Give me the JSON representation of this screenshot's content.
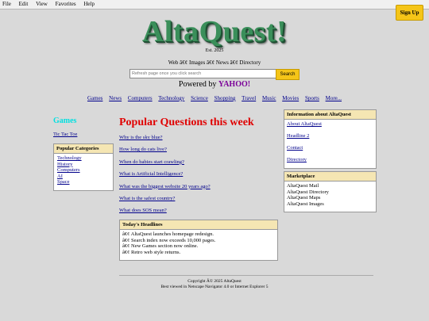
{
  "menubar": [
    "File",
    "Edit",
    "View",
    "Favorites",
    "Help"
  ],
  "signup_label": "Sign Up",
  "logo": "AltaQuest!",
  "est": "Est. 2025",
  "tabs_line": "Web â€¢ Images â€¢ News â€¢ Directory",
  "search": {
    "placeholder": "Refresh page once you click search",
    "button": "Search"
  },
  "powered": {
    "prefix": "Powered by ",
    "brand": "YAHOO!"
  },
  "categories": [
    "Games",
    "News",
    "Computers",
    "Technology",
    "Science",
    "Shopping",
    "Travel",
    "Music",
    "Movies",
    "Sports",
    "More..."
  ],
  "left": {
    "games_title": "Games",
    "tictactoe": "Tic Tac Toe",
    "popular_categories": {
      "title": "Popular Categories",
      "items": [
        "Technology",
        "History",
        "Computers",
        "AI",
        "Space"
      ]
    }
  },
  "center": {
    "title": "Popular Questions this week",
    "questions": [
      "Why is the sky blue?",
      "How long do cats live?",
      "When do babies start crawling?",
      "What is Artificial Intelligence?",
      "What was the biggest website 20 years ago?",
      "What is the safest country?",
      "What does SOS mean?"
    ],
    "headlines": {
      "title": "Today's Headlines",
      "items": [
        "â€¢ AltaQuest launches homepage redesign.",
        "â€¢ Search index now exceeds 10,000 pages.",
        "â€¢ New Games section now online.",
        "â€¢ Retro web style returns."
      ]
    }
  },
  "right": {
    "info": {
      "title": "Information about AltaQuest",
      "links": [
        "About AltaQuest",
        "Headline 2",
        "Contact",
        "Directory"
      ]
    },
    "marketplace": {
      "title": "Marketplace",
      "items": [
        "AltaQuest Mail",
        "AltaQuest Directory",
        "AltaQuest Maps",
        "AltaQuest Images"
      ]
    }
  },
  "footer": {
    "copyright": "Copyright Â© 2025 AltaQuest",
    "best_viewed": "Best viewed in Netscape Navigator 4.0 or Internet Explorer 5"
  }
}
